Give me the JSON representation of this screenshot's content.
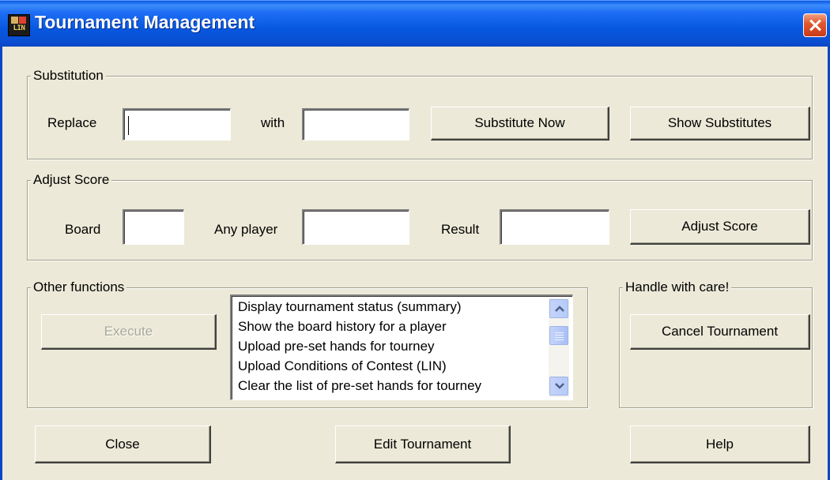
{
  "window": {
    "title": "Tournament Management",
    "icon_text": "LIN"
  },
  "substitution": {
    "group_label": "Substitution",
    "replace_label": "Replace",
    "replace_value": "",
    "with_label": "with",
    "with_value": "",
    "substitute_button": "Substitute Now",
    "show_button": "Show Substitutes"
  },
  "adjust": {
    "group_label": "Adjust Score",
    "board_label": "Board",
    "board_value": "",
    "player_label": "Any player",
    "player_value": "",
    "result_label": "Result",
    "result_value": "",
    "adjust_button": "Adjust Score"
  },
  "other": {
    "group_label": "Other functions",
    "execute_button": "Execute",
    "list_items": [
      "Display tournament status (summary)",
      "Show the board history for a player",
      "Upload pre-set hands for tourney",
      "Upload Conditions of Contest (LIN)",
      "Clear the list of pre-set hands for tourney"
    ]
  },
  "care": {
    "group_label": "Handle with care!",
    "cancel_button": "Cancel Tournament"
  },
  "footer": {
    "close_button": "Close",
    "edit_button": "Edit Tournament",
    "help_button": "Help"
  },
  "icons": {
    "app": "lin-app-icon",
    "close": "close-icon",
    "scroll_up": "scroll-up-arrow-icon",
    "scroll_down": "scroll-down-arrow-icon"
  },
  "colors": {
    "title_bar": "#0a58e6",
    "window_face": "#ece9d8",
    "close_button": "#e05a30"
  }
}
